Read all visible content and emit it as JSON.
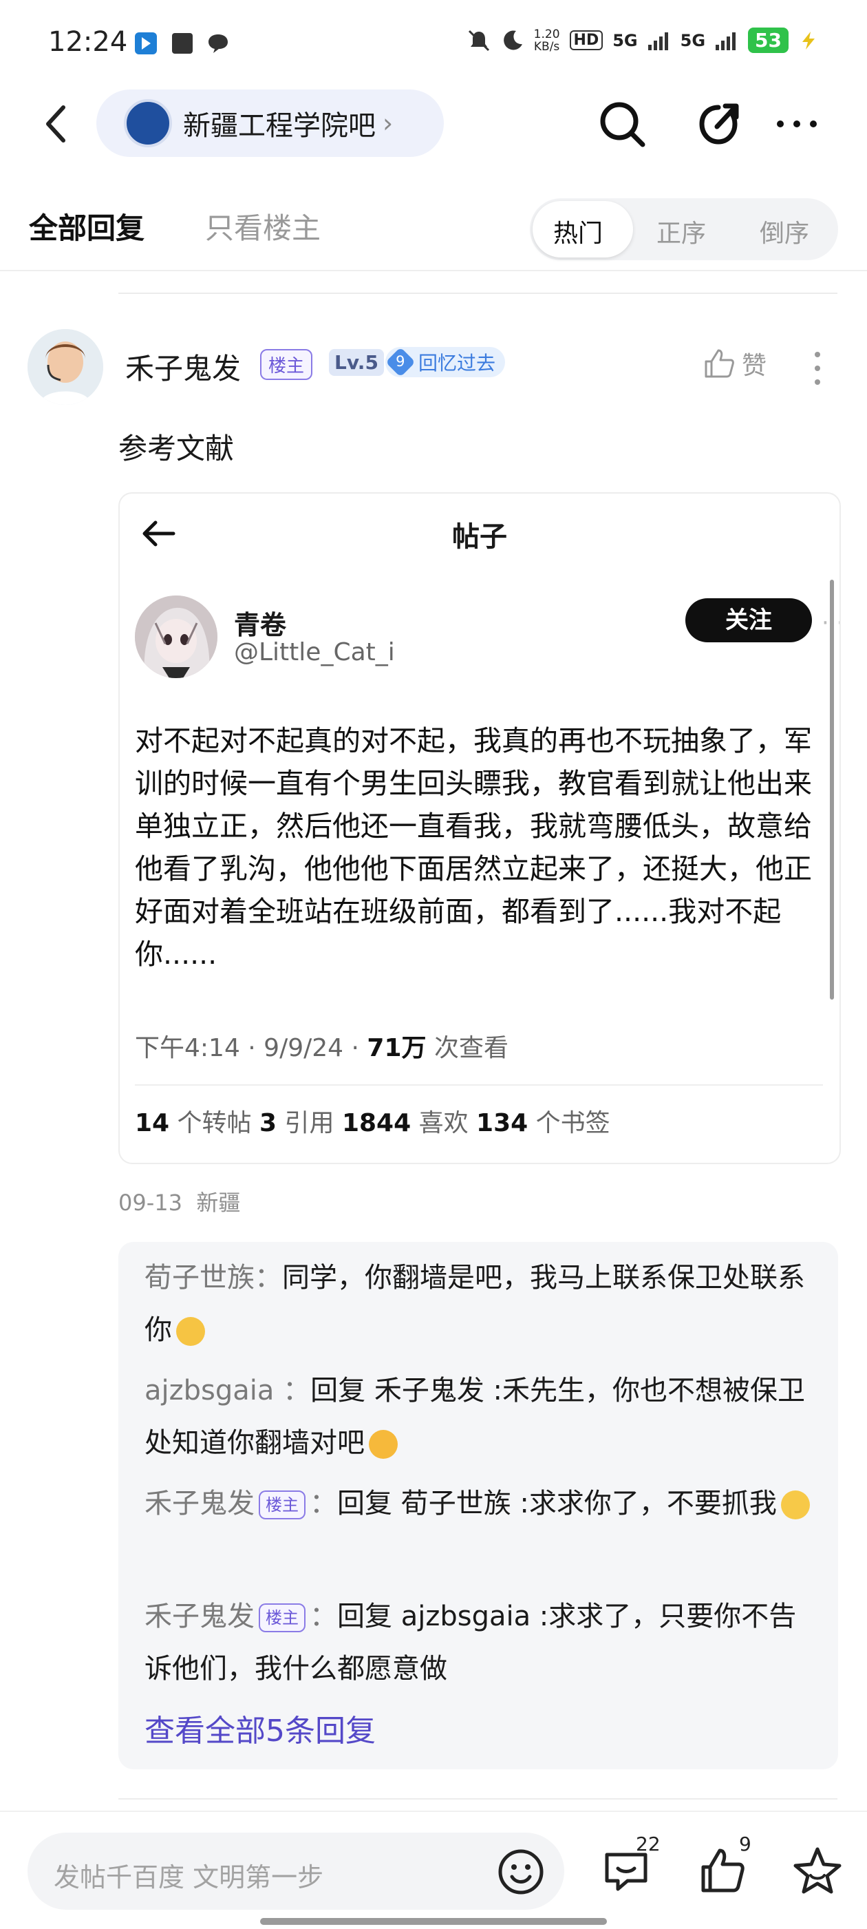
{
  "status_bar": {
    "time": "12:24",
    "net_speed_value": "1.20",
    "net_speed_unit": "KB/s",
    "hd_label": "HD",
    "sim1": "5G",
    "sim2": "5G",
    "battery": "53"
  },
  "header": {
    "forum_name": "新疆工程学院吧",
    "forum_chevron": "›"
  },
  "tabs": {
    "all_replies": "全部回复",
    "owner_only": "只看楼主",
    "sort": [
      "热门",
      "正序",
      "倒序"
    ],
    "sort_selected": "热门"
  },
  "post": {
    "username": "禾子鬼发",
    "owner_badge": "楼主",
    "level": "Lv.5",
    "memory_count": "9",
    "memory_label": "回忆过去",
    "like_label": "赞",
    "text": "参考文献",
    "date": "09-13",
    "location": "新疆"
  },
  "embedded": {
    "title": "帖子",
    "author_name": "青卷",
    "author_handle": "@Little_Cat_i",
    "follow_label": "关注",
    "body": "对不起对不起真的对不起，我真的再也不玩抽象了，军训的时候一直有个男生回头瞟我，教官看到就让他出来单独立正，然后他还一直看我，我就弯腰低头，故意给他看了乳沟，他他他下面居然立起来了，还挺大，他正好面对着全班站在班级前面，都看到了......我对不起你......",
    "meta_time": "下午4:14 · 9/9/24 · ",
    "meta_views": "71万",
    "meta_views_label": " 次查看",
    "reposts": "14",
    "reposts_label": " 个转帖  ",
    "quotes": "3",
    "quotes_label": " 引用  ",
    "likes": "1844",
    "likes_label": " 喜欢  ",
    "bookmarks": "134",
    "bookmarks_label": " 个书签"
  },
  "replies": {
    "items": [
      {
        "name": "荀子世族",
        "sep": "：",
        "text": "同学，你翻墙是吧，我马上联系保卫处联系你",
        "owner": false,
        "emoji_color": "#f6c443"
      },
      {
        "name": "ajzbsgaia",
        "sep": " ：",
        "text": "回复 禾子鬼发 :禾先生，你也不想被保卫处知道你翻墙对吧",
        "owner": false,
        "emoji_color": "#f6b93b"
      },
      {
        "name": "禾子鬼发",
        "sep": "：",
        "text": "回复 荀子世族 :求求你了，不要抓我",
        "owner": true,
        "emoji_color": "#f7c948"
      },
      {
        "name": "禾子鬼发",
        "sep": "：",
        "text": "回复 ajzbsgaia  :求求了，只要你不告诉他们，我什么都愿意做",
        "owner": true,
        "emoji_color": null
      }
    ],
    "owner_badge": "楼主",
    "view_all": "查看全部5条回复"
  },
  "bottom_bar": {
    "input_placeholder": "发帖千百度 文明第一步",
    "comment_count": "22",
    "like_count": "9"
  }
}
